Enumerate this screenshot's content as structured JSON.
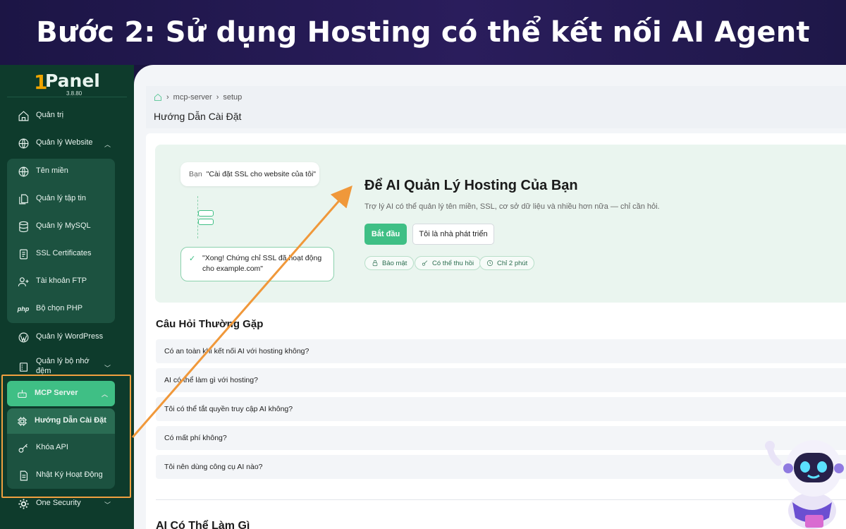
{
  "banner": {
    "title": "Bước 2: Sử dụng Hosting có thể kết nối AI Agent"
  },
  "logo": {
    "one": "1",
    "name": "Panel",
    "version": "3.8.80"
  },
  "sidebar": {
    "items": [
      {
        "label": "Quản trị",
        "icon": "home-icon"
      },
      {
        "label": "Quản lý Website",
        "icon": "globe-icon",
        "expanded": true
      },
      {
        "label": "Tên miền",
        "icon": "globe-icon"
      },
      {
        "label": "Quản lý tập tin",
        "icon": "files-icon"
      },
      {
        "label": "Quản lý MySQL",
        "icon": "database-icon"
      },
      {
        "label": "SSL Certificates",
        "icon": "certificate-icon"
      },
      {
        "label": "Tài khoản FTP",
        "icon": "user-plus-icon"
      },
      {
        "label": "Bộ chọn PHP",
        "icon": "php-icon",
        "icon_text": "php"
      },
      {
        "label": "Quản lý WordPress",
        "icon": "wordpress-icon"
      },
      {
        "label": "Quản lý bộ nhớ đệm",
        "icon": "cache-icon"
      },
      {
        "label": "MCP Server",
        "icon": "robot-icon",
        "active": true
      },
      {
        "label": "Hướng Dẫn Cài Đặt",
        "icon": "chip-icon",
        "active": true
      },
      {
        "label": "Khóa API",
        "icon": "key-icon"
      },
      {
        "label": "Nhật Ký Hoạt Động",
        "icon": "log-icon"
      },
      {
        "label": "One Security",
        "icon": "gear-icon"
      }
    ]
  },
  "breadcrumb": {
    "items": [
      "mcp-server",
      "setup"
    ]
  },
  "page": {
    "title": "Hướng Dẫn Cài Đặt"
  },
  "hero": {
    "chat_user_label": "Bạn",
    "chat_user_text": "\"Cài đặt SSL cho website của tôi\"",
    "chat_reply_line1": "\"Xong! Chứng chỉ SSL đã hoạt động",
    "chat_reply_line2": "cho example.com\"",
    "title": "Để AI Quản Lý Hosting Của Bạn",
    "subtitle": "Trợ lý AI có thể quản lý tên miền, SSL, cơ sở dữ liệu và nhiều hơn nữa — chỉ cần hỏi.",
    "start_button": "Bắt đầu",
    "developer_button": "Tôi là nhà phát triển",
    "pills": [
      "Bảo mật",
      "Có thể thu hồi",
      "Chỉ 2 phút"
    ]
  },
  "faq": {
    "title": "Câu Hỏi Thường Gặp",
    "items": [
      "Có an toàn khi kết nối AI với hosting không?",
      "AI có thể làm gì với hosting?",
      "Tôi có thể tắt quyền truy cập AI không?",
      "Có mất phí không?",
      "Tôi nên dùng công cụ AI nào?"
    ]
  },
  "next_section": {
    "title": "AI Có Thể Làm Gì"
  },
  "colors": {
    "accent": "#3fbf85",
    "sidebar": "#0e3b2c",
    "highlight": "#f0a040",
    "banner": "#1c1545"
  }
}
